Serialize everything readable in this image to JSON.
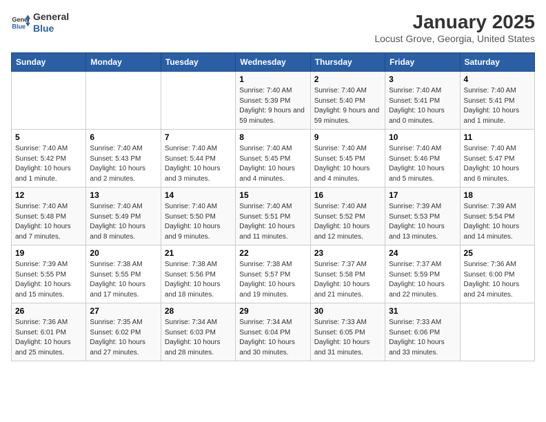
{
  "header": {
    "logo_line1": "General",
    "logo_line2": "Blue",
    "title": "January 2025",
    "subtitle": "Locust Grove, Georgia, United States"
  },
  "days_of_week": [
    "Sunday",
    "Monday",
    "Tuesday",
    "Wednesday",
    "Thursday",
    "Friday",
    "Saturday"
  ],
  "weeks": [
    [
      {
        "num": "",
        "info": ""
      },
      {
        "num": "",
        "info": ""
      },
      {
        "num": "",
        "info": ""
      },
      {
        "num": "1",
        "info": "Sunrise: 7:40 AM\nSunset: 5:39 PM\nDaylight: 9 hours and 59 minutes."
      },
      {
        "num": "2",
        "info": "Sunrise: 7:40 AM\nSunset: 5:40 PM\nDaylight: 9 hours and 59 minutes."
      },
      {
        "num": "3",
        "info": "Sunrise: 7:40 AM\nSunset: 5:41 PM\nDaylight: 10 hours and 0 minutes."
      },
      {
        "num": "4",
        "info": "Sunrise: 7:40 AM\nSunset: 5:41 PM\nDaylight: 10 hours and 1 minute."
      }
    ],
    [
      {
        "num": "5",
        "info": "Sunrise: 7:40 AM\nSunset: 5:42 PM\nDaylight: 10 hours and 1 minute."
      },
      {
        "num": "6",
        "info": "Sunrise: 7:40 AM\nSunset: 5:43 PM\nDaylight: 10 hours and 2 minutes."
      },
      {
        "num": "7",
        "info": "Sunrise: 7:40 AM\nSunset: 5:44 PM\nDaylight: 10 hours and 3 minutes."
      },
      {
        "num": "8",
        "info": "Sunrise: 7:40 AM\nSunset: 5:45 PM\nDaylight: 10 hours and 4 minutes."
      },
      {
        "num": "9",
        "info": "Sunrise: 7:40 AM\nSunset: 5:45 PM\nDaylight: 10 hours and 4 minutes."
      },
      {
        "num": "10",
        "info": "Sunrise: 7:40 AM\nSunset: 5:46 PM\nDaylight: 10 hours and 5 minutes."
      },
      {
        "num": "11",
        "info": "Sunrise: 7:40 AM\nSunset: 5:47 PM\nDaylight: 10 hours and 6 minutes."
      }
    ],
    [
      {
        "num": "12",
        "info": "Sunrise: 7:40 AM\nSunset: 5:48 PM\nDaylight: 10 hours and 7 minutes."
      },
      {
        "num": "13",
        "info": "Sunrise: 7:40 AM\nSunset: 5:49 PM\nDaylight: 10 hours and 8 minutes."
      },
      {
        "num": "14",
        "info": "Sunrise: 7:40 AM\nSunset: 5:50 PM\nDaylight: 10 hours and 9 minutes."
      },
      {
        "num": "15",
        "info": "Sunrise: 7:40 AM\nSunset: 5:51 PM\nDaylight: 10 hours and 11 minutes."
      },
      {
        "num": "16",
        "info": "Sunrise: 7:40 AM\nSunset: 5:52 PM\nDaylight: 10 hours and 12 minutes."
      },
      {
        "num": "17",
        "info": "Sunrise: 7:39 AM\nSunset: 5:53 PM\nDaylight: 10 hours and 13 minutes."
      },
      {
        "num": "18",
        "info": "Sunrise: 7:39 AM\nSunset: 5:54 PM\nDaylight: 10 hours and 14 minutes."
      }
    ],
    [
      {
        "num": "19",
        "info": "Sunrise: 7:39 AM\nSunset: 5:55 PM\nDaylight: 10 hours and 15 minutes."
      },
      {
        "num": "20",
        "info": "Sunrise: 7:38 AM\nSunset: 5:55 PM\nDaylight: 10 hours and 17 minutes."
      },
      {
        "num": "21",
        "info": "Sunrise: 7:38 AM\nSunset: 5:56 PM\nDaylight: 10 hours and 18 minutes."
      },
      {
        "num": "22",
        "info": "Sunrise: 7:38 AM\nSunset: 5:57 PM\nDaylight: 10 hours and 19 minutes."
      },
      {
        "num": "23",
        "info": "Sunrise: 7:37 AM\nSunset: 5:58 PM\nDaylight: 10 hours and 21 minutes."
      },
      {
        "num": "24",
        "info": "Sunrise: 7:37 AM\nSunset: 5:59 PM\nDaylight: 10 hours and 22 minutes."
      },
      {
        "num": "25",
        "info": "Sunrise: 7:36 AM\nSunset: 6:00 PM\nDaylight: 10 hours and 24 minutes."
      }
    ],
    [
      {
        "num": "26",
        "info": "Sunrise: 7:36 AM\nSunset: 6:01 PM\nDaylight: 10 hours and 25 minutes."
      },
      {
        "num": "27",
        "info": "Sunrise: 7:35 AM\nSunset: 6:02 PM\nDaylight: 10 hours and 27 minutes."
      },
      {
        "num": "28",
        "info": "Sunrise: 7:34 AM\nSunset: 6:03 PM\nDaylight: 10 hours and 28 minutes."
      },
      {
        "num": "29",
        "info": "Sunrise: 7:34 AM\nSunset: 6:04 PM\nDaylight: 10 hours and 30 minutes."
      },
      {
        "num": "30",
        "info": "Sunrise: 7:33 AM\nSunset: 6:05 PM\nDaylight: 10 hours and 31 minutes."
      },
      {
        "num": "31",
        "info": "Sunrise: 7:33 AM\nSunset: 6:06 PM\nDaylight: 10 hours and 33 minutes."
      },
      {
        "num": "",
        "info": ""
      }
    ]
  ]
}
